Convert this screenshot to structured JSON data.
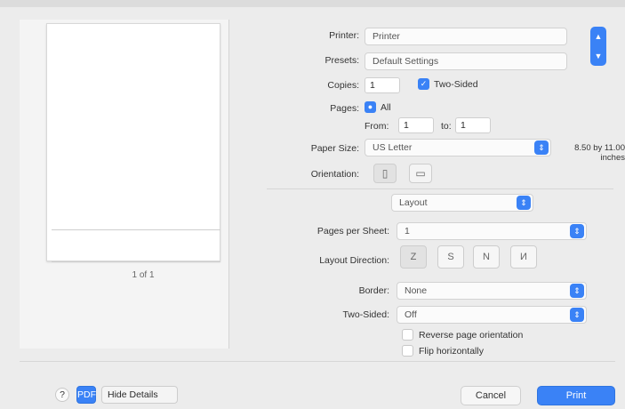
{
  "preview": {
    "page_indicator": "1 of 1"
  },
  "printer": {
    "label": "Printer:",
    "value": "Printer"
  },
  "presets": {
    "label": "Presets:",
    "value": "Default Settings"
  },
  "copies": {
    "label": "Copies:",
    "value": "1",
    "two_sided_label": "Two-Sided"
  },
  "pages": {
    "label": "Pages:",
    "all_label": "All",
    "from_label": "From:",
    "from_value": "1",
    "to_label": "to:",
    "to_value": "1"
  },
  "paper_size": {
    "label": "Paper Size:",
    "value": "US Letter",
    "dimensions": "8.50 by 11.00 inches"
  },
  "orientation": {
    "label": "Orientation:"
  },
  "app_menu": {
    "value": "Layout"
  },
  "layout": {
    "pages_per_sheet_label": "Pages per Sheet:",
    "pages_per_sheet_value": "1",
    "direction_label": "Layout Direction:",
    "direction_icons": [
      "Z",
      "S",
      "N",
      "И"
    ],
    "border_label": "Border:",
    "border_value": "None",
    "two_sided_label": "Two-Sided:",
    "two_sided_value": "Off",
    "reverse_label": "Reverse page orientation",
    "flip_label": "Flip horizontally"
  },
  "footer": {
    "help": "?",
    "pdf_label": "PDF",
    "hide_details": "Hide Details",
    "cancel": "Cancel",
    "print": "Print"
  },
  "colors": {
    "accent": "#3a82f6",
    "background": "#ececec"
  }
}
